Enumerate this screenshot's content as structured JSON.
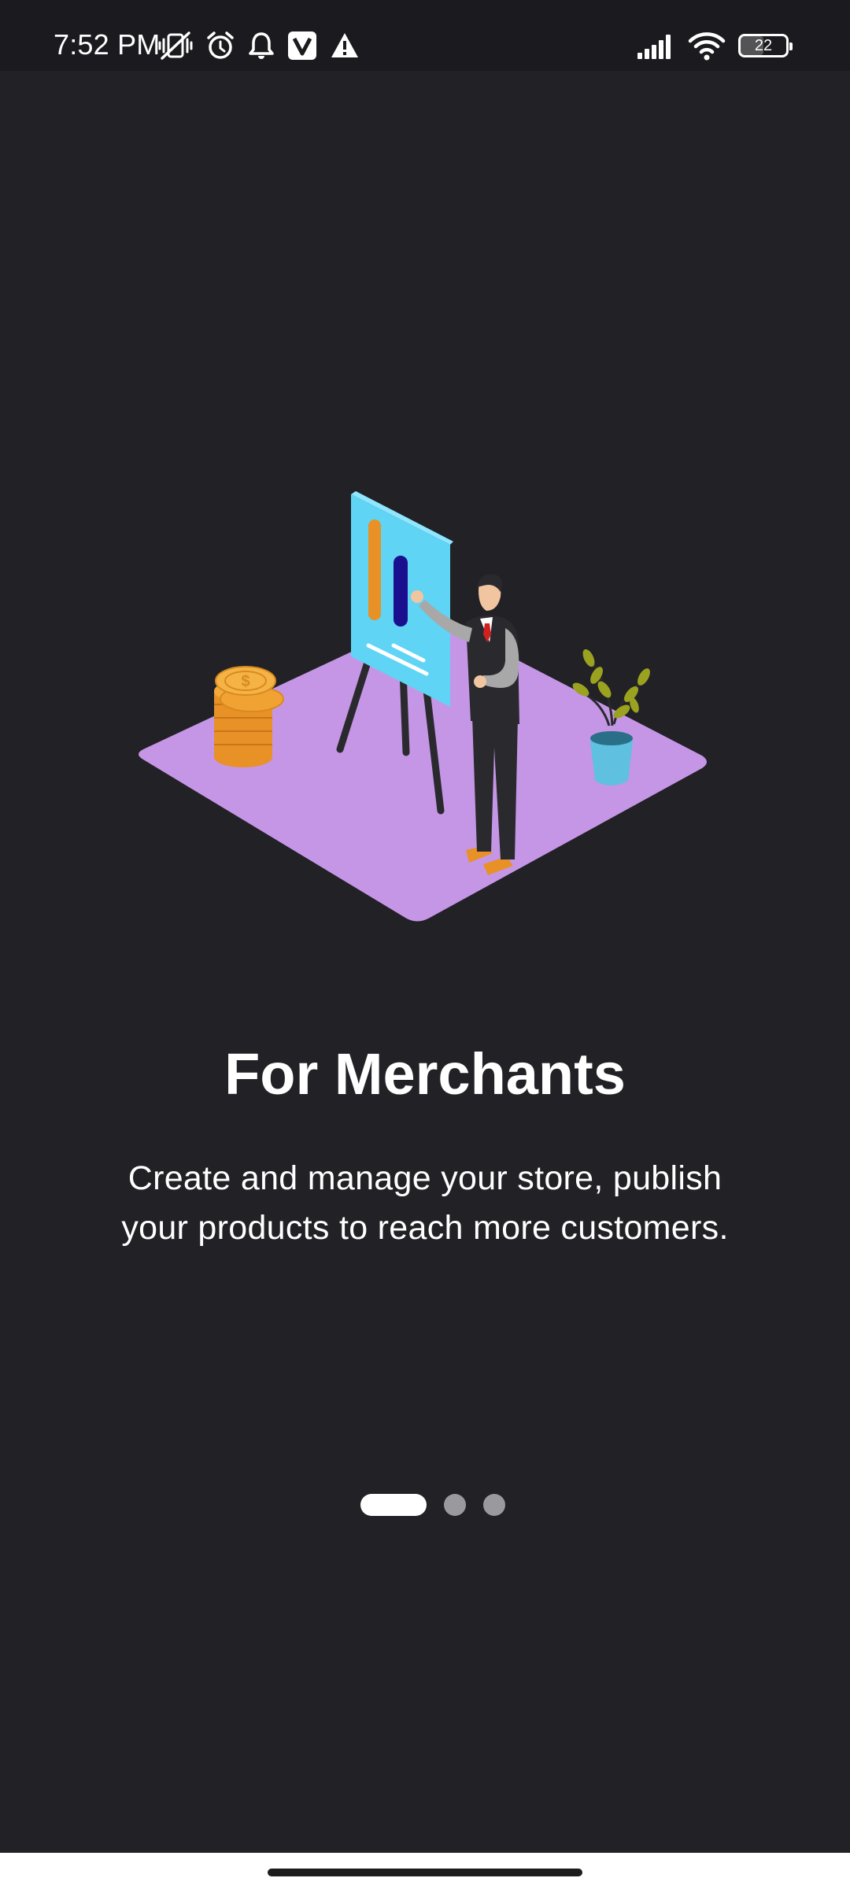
{
  "status_bar": {
    "time": "7:52 PM",
    "battery_level": "22",
    "icons_left": [
      "vibrate-off-icon",
      "alarm-icon",
      "notification-bell-icon",
      "v-app-icon",
      "warning-icon"
    ],
    "icons_right": [
      "signal-icon",
      "wifi-icon",
      "battery-icon"
    ]
  },
  "onboarding": {
    "illustration": "merchant-presentation-illustration",
    "title": "For Merchants",
    "description": "Create and manage your store, publish your products to reach more customers."
  },
  "page_indicator": {
    "total": 3,
    "current": 1
  },
  "colors": {
    "background": "#212126",
    "text": "#ffffff",
    "indicator_active": "#ffffff",
    "indicator_inactive": "#9a9a9e",
    "platform": "#c596e6"
  }
}
